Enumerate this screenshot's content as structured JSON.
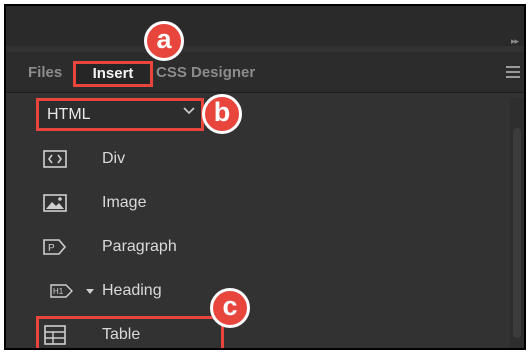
{
  "panel": {
    "tabs": [
      "Files",
      "Insert",
      "CSS Designer"
    ],
    "active_tab": "Insert"
  },
  "insert": {
    "category": "HTML",
    "items": [
      {
        "label": "Div",
        "icon": "div-tag-icon"
      },
      {
        "label": "Image",
        "icon": "image-icon"
      },
      {
        "label": "Paragraph",
        "icon": "paragraph-icon"
      },
      {
        "label": "Heading",
        "icon": "heading-icon"
      },
      {
        "label": "Table",
        "icon": "table-icon"
      }
    ]
  },
  "callouts": {
    "a": "a",
    "b": "b",
    "c": "c"
  },
  "colors": {
    "callout": "#e8453c",
    "panel": "#323232"
  }
}
